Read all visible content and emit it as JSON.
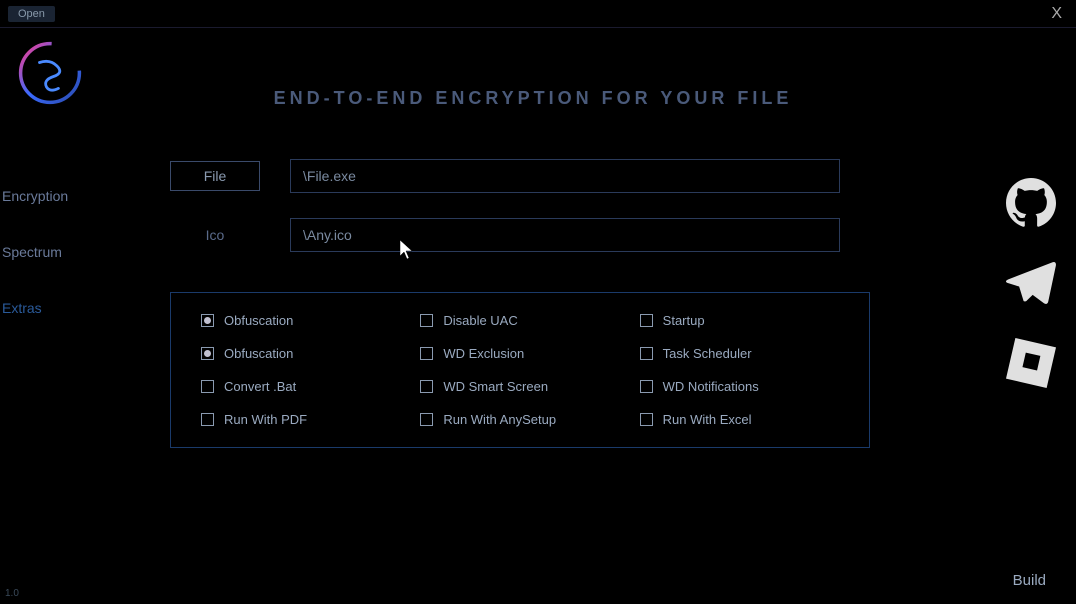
{
  "titlebar": {
    "open_label": "Open",
    "close_label": "X"
  },
  "header": {
    "title": "END-TO-END ENCRYPTION FOR YOUR FILE"
  },
  "sidebar": {
    "items": [
      {
        "label": "Encryption",
        "active": false
      },
      {
        "label": "Spectrum",
        "active": false
      },
      {
        "label": "Extras",
        "active": true
      }
    ]
  },
  "inputs": {
    "file_label": "File",
    "file_value": "\\File.exe",
    "ico_label": "Ico",
    "ico_value": "\\Any.ico"
  },
  "options": {
    "col1": [
      {
        "label": "Obfuscation",
        "checked": true
      },
      {
        "label": "Obfuscation",
        "checked": true
      },
      {
        "label": "Convert .Bat",
        "checked": false
      },
      {
        "label": "Run With PDF",
        "checked": false
      }
    ],
    "col2": [
      {
        "label": "Disable UAC",
        "checked": false
      },
      {
        "label": "WD Exclusion",
        "checked": false
      },
      {
        "label": "WD Smart Screen",
        "checked": false
      },
      {
        "label": "Run With AnySetup",
        "checked": false
      }
    ],
    "col3": [
      {
        "label": "Startup",
        "checked": false
      },
      {
        "label": "Task Scheduler",
        "checked": false
      },
      {
        "label": "WD Notifications",
        "checked": false
      },
      {
        "label": "Run With Excel",
        "checked": false
      }
    ]
  },
  "social": {
    "github": "github-icon",
    "telegram": "telegram-icon",
    "roblox": "roblox-icon"
  },
  "footer": {
    "build_label": "Build",
    "version": "1.0"
  }
}
